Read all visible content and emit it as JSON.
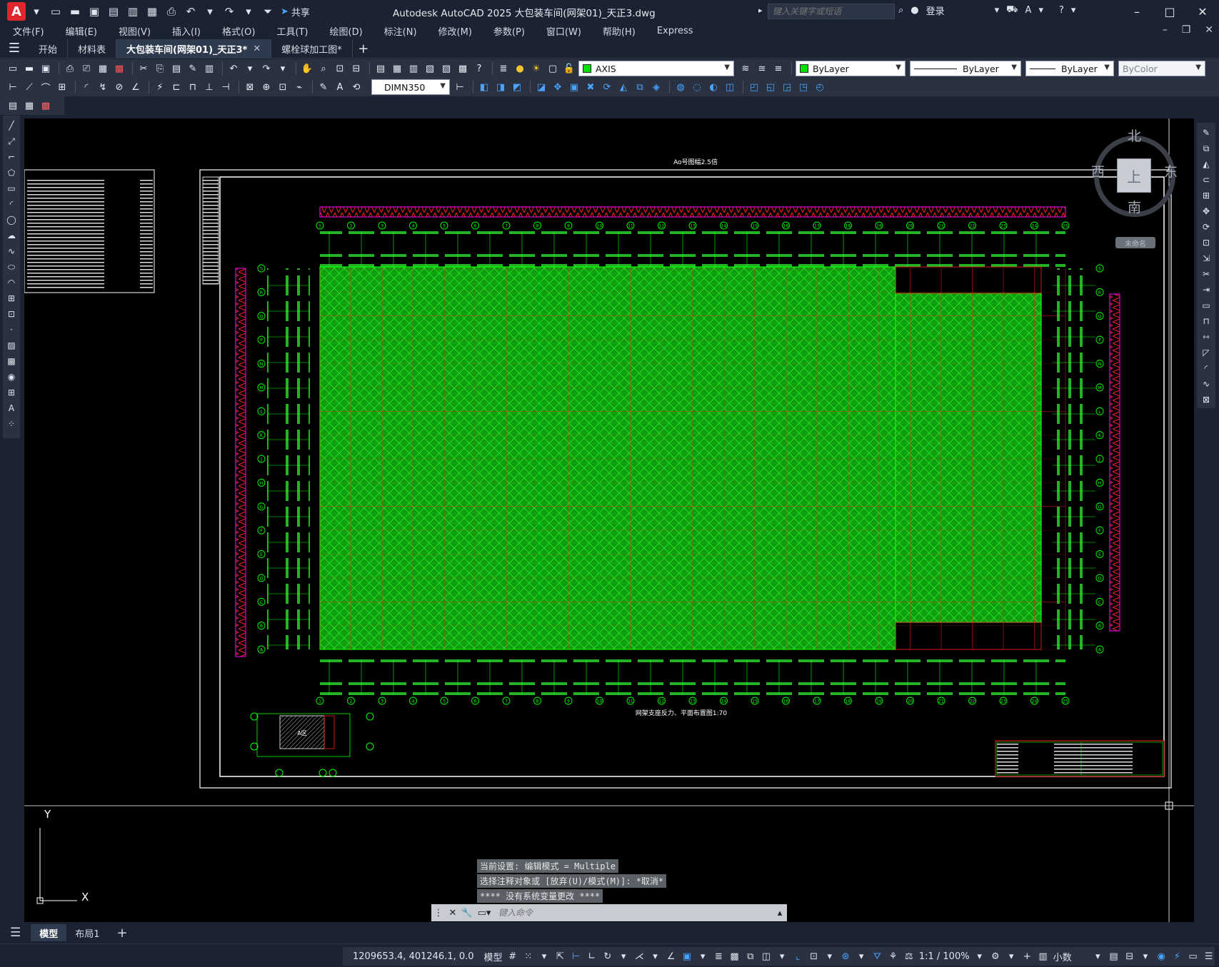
{
  "window": {
    "app_logo": "A",
    "title": "Autodesk AutoCAD 2025    大包装车间(网架01)_天正3.dwg",
    "search_placeholder": "键入关键字或短语",
    "login_label": "登录",
    "share_label": "共享"
  },
  "menu": {
    "items": [
      "文件(F)",
      "编辑(E)",
      "视图(V)",
      "插入(I)",
      "格式(O)",
      "工具(T)",
      "绘图(D)",
      "标注(N)",
      "修改(M)",
      "参数(P)",
      "窗口(W)",
      "帮助(H)",
      "Express"
    ]
  },
  "tabs": {
    "items": [
      {
        "label": "开始",
        "active": false,
        "closable": false
      },
      {
        "label": "材料表",
        "active": false,
        "closable": false
      },
      {
        "label": "大包装车间(网架01)_天正3*",
        "active": true,
        "closable": true
      },
      {
        "label": "螺栓球加工图*",
        "active": false,
        "closable": false
      }
    ]
  },
  "toolbar": {
    "layer_name": "AXIS",
    "color_value": "ByLayer",
    "linetype_value": "ByLayer",
    "lineweight_value": "ByLayer",
    "plotstyle_value": "ByColor",
    "dimstyle_value": "DIMN350"
  },
  "navcube": {
    "north": "北",
    "south": "南",
    "east": "东",
    "west": "西",
    "top": "上",
    "wcs": "未命名"
  },
  "drawing": {
    "sheet_title": "Ao号图幅2.5倍",
    "plan_caption": "网架支座反力、平面布置图1:70",
    "detail_cell": "A区",
    "axis_letters": [
      "S",
      "R",
      "Q",
      "P",
      "N",
      "M",
      "L",
      "K",
      "J",
      "H",
      "G",
      "F",
      "E",
      "D",
      "C",
      "B",
      "A"
    ],
    "axis_numbers": [
      "1",
      "2",
      "3",
      "4",
      "5",
      "6",
      "7",
      "8",
      "9",
      "10",
      "11",
      "12",
      "13",
      "14",
      "15",
      "16",
      "17",
      "18",
      "19",
      "20",
      "21",
      "22",
      "23",
      "24",
      "25"
    ]
  },
  "ucs": {
    "x_label": "X",
    "y_label": "Y"
  },
  "command": {
    "history": [
      "当前设置: 编辑模式 = Multiple",
      "选择注释对象或 [放弃(U)/模式(M)]: *取消*",
      "**** 没有系统变量更改 ****"
    ],
    "placeholder": "键入命令"
  },
  "layouts": {
    "items": [
      {
        "label": "模型",
        "active": true
      },
      {
        "label": "布局1",
        "active": false
      }
    ]
  },
  "status": {
    "coordinates": "1209653.4, 401246.1, 0.0",
    "space": "模型",
    "scale": "1:1 / 100%",
    "units": "小数"
  },
  "colors": {
    "canvas": "#000000",
    "mesh": "#00cc00",
    "truss_red": "#ff2020",
    "truss_magenta": "#ff00ff",
    "border_white": "#ffffff"
  }
}
